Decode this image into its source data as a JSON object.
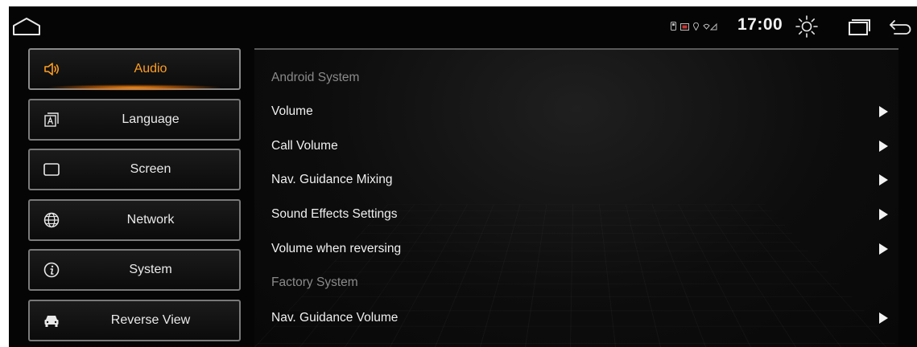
{
  "status_bar": {
    "time": "17:00",
    "icons": [
      "home-icon",
      "sd-card-icon",
      "usb-icon",
      "location-icon",
      "wifi-signal-icon",
      "brightness-icon",
      "recents-icon",
      "back-icon"
    ]
  },
  "sidebar": {
    "items": [
      {
        "label": "Audio",
        "icon": "speaker-icon",
        "active": true
      },
      {
        "label": "Language",
        "icon": "language-icon",
        "active": false
      },
      {
        "label": "Screen",
        "icon": "screen-icon",
        "active": false
      },
      {
        "label": "Network",
        "icon": "globe-icon",
        "active": false
      },
      {
        "label": "System",
        "icon": "info-icon",
        "active": false
      },
      {
        "label": "Reverse View",
        "icon": "car-icon",
        "active": false
      }
    ]
  },
  "main": {
    "rows": [
      {
        "label": "Android System",
        "type": "header"
      },
      {
        "label": "Volume",
        "type": "item"
      },
      {
        "label": "Call Volume",
        "type": "item"
      },
      {
        "label": "Nav. Guidance Mixing",
        "type": "item"
      },
      {
        "label": "Sound Effects Settings",
        "type": "item"
      },
      {
        "label": "Volume when reversing",
        "type": "item"
      },
      {
        "label": "Factory System",
        "type": "header"
      },
      {
        "label": "Nav. Guidance Volume",
        "type": "item"
      }
    ]
  },
  "colors": {
    "accent": "#ff9e1f",
    "background": "#050505",
    "text": "#f0f0f0",
    "header_text": "#8a8a8a"
  }
}
